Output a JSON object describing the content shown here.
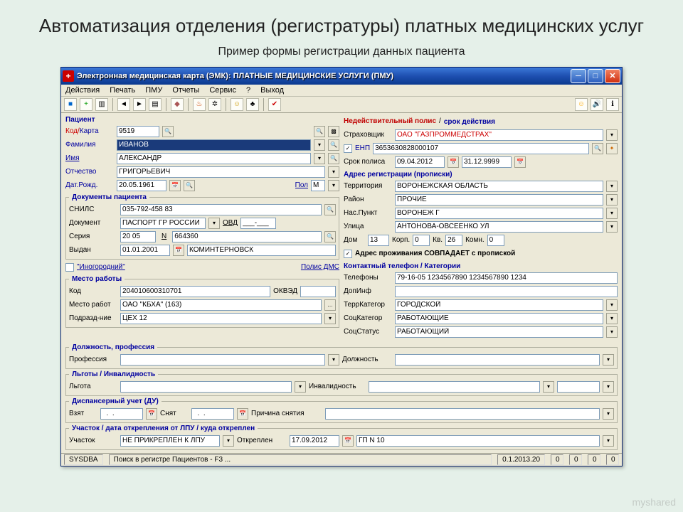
{
  "slide": {
    "title": "Автоматизация   отделения  (регистратуры)  платных медицинских  услуг",
    "subtitle": "Пример формы регистрации данных пациента"
  },
  "window": {
    "title": "Электронная медицинская карта (ЭМК): ПЛАТНЫЕ МЕДИЦИНСКИЕ УСЛУГИ (ПМУ)"
  },
  "menu": {
    "actions": "Действия",
    "print": "Печать",
    "pmu": "ПМУ",
    "reports": "Отчеты",
    "service": "Сервис",
    "help": "?",
    "exit": "Выход"
  },
  "patient": {
    "section": "Пациент",
    "code_label": "Код/",
    "card_label": "Карта",
    "code": "9519",
    "surname_label": "Фамилия",
    "surname": "ИВАНОВ",
    "name_label": "Имя",
    "name": "АЛЕКСАНДР",
    "patronymic_label": "Отчество",
    "patronymic": "ГРИГОРЬЕВИЧ",
    "dob_label": "Дат.Рожд.",
    "dob": "20.05.1961",
    "sex_label": "Пол",
    "sex": "М"
  },
  "documents": {
    "section": "Документы пациента",
    "snils_label": "СНИЛС",
    "snils": "035-792-458 83",
    "doc_label": "Документ",
    "doc": "ПАСПОРТ ГР РОССИИ",
    "ovd_label": "ОВД",
    "ovd": "___-___",
    "series_label": "Серия",
    "series": "20 05",
    "n_label": "N",
    "number": "664360",
    "issued_label": "Выдан",
    "issued_date": "01.01.2001",
    "issued_by": "КОМИНТЕРНОВСК"
  },
  "inogorod": {
    "label": "\"Иногородний\"",
    "dms_label": "Полис ДМС"
  },
  "work": {
    "section": "Место работы",
    "code_label": "Код",
    "code": "204010600310701",
    "okved_label": "ОКВЭД",
    "place_label": "Место работ",
    "place": "ОАО \"КБХА\" (163)",
    "dept_label": "Подразд-ние",
    "dept": "ЦЕХ 12"
  },
  "prof": {
    "section": "Должность, профессия",
    "profession_label": "Профессия",
    "position_label": "Должность"
  },
  "benefits": {
    "section": "Льготы / Инвалидность",
    "benefit_label": "Льгота",
    "disability_label": "Инвалидность"
  },
  "disp": {
    "section": "Диспансерный учет (ДУ)",
    "taken_label": "Взят",
    "taken": "  .  .",
    "removed_label": "Снят",
    "removed": "  .  .",
    "reason_label": "Причина снятия"
  },
  "section_area": {
    "section": "Участок / дата открепления от ЛПУ / куда откреплен",
    "area_label": "Участок",
    "area": "НЕ ПРИКРЕПЛЕН К ЛПУ",
    "detached_label": "Откреплен",
    "detached_date": "17.09.2012",
    "detached_to": "ГП N 10"
  },
  "policy": {
    "warn_prefix": "Недействительный полис",
    "warn_sep": " / ",
    "warn_suffix": "срок действия",
    "insurer_label": "Страховщик",
    "insurer": "ОАО \"ГАЗПРОММЕДСТРАХ\"",
    "enp_label": "ЕНП",
    "enp": "3653630828000107",
    "term_label": "Срок полиса",
    "from": "09.04.2012",
    "to": "31.12.9999"
  },
  "address": {
    "section": "Адрес регистрации (прописки)",
    "territory_label": "Территория",
    "territory": "ВОРОНЕЖСКАЯ ОБЛАСТЬ",
    "district_label": "Район",
    "district": "ПРОЧИЕ",
    "city_label": "Нас.Пункт",
    "city": "ВОРОНЕЖ Г",
    "street_label": "Улица",
    "street": "АНТОНОВА-ОВСЕЕНКО УЛ",
    "house_label": "Дом",
    "house": "13",
    "korp_label": "Корп.",
    "korp": "0",
    "kv_label": "Кв.",
    "kv": "26",
    "komn_label": "Комн.",
    "komn": "0",
    "same_label": "Адрес проживания СОВПАДАЕТ с пропиской"
  },
  "contact": {
    "section": "Контактный телефон / Категории",
    "phones_label": "Телефоны",
    "phones": "79-16-05 1234567890 1234567890 1234",
    "addinfo_label": "ДопИнф",
    "terr_cat_label": "ТеррКатегор",
    "terr_cat": "ГОРОДСКОЙ",
    "soc_cat_label": "СоцКатегор",
    "soc_cat": "РАБОТАЮЩИЕ",
    "soc_status_label": "СоцСтатус",
    "soc_status": "РАБОТАЮЩИЙ"
  },
  "status": {
    "user": "SYSDBA",
    "hint": "Поиск в регистре Пациентов - F3 ...",
    "version": "0.1.2013.20",
    "n1": "0",
    "n2": "0",
    "n3": "0",
    "n4": "0"
  },
  "watermark": "myshared"
}
